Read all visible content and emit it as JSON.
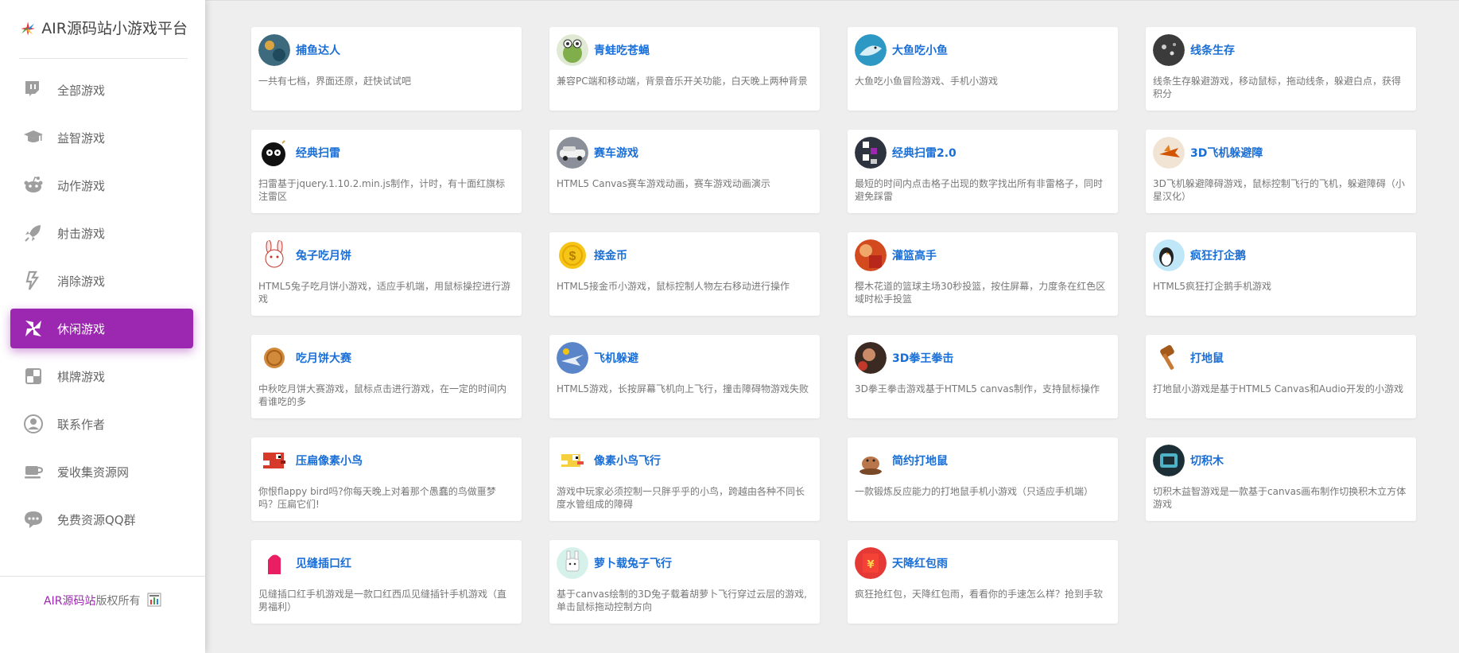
{
  "sidebar": {
    "brand_title": "AIR源码站小游戏平台",
    "items": [
      {
        "label": "全部游戏",
        "icon": "twitch-icon"
      },
      {
        "label": "益智游戏",
        "icon": "graduation-cap-icon"
      },
      {
        "label": "动作游戏",
        "icon": "reddit-robot-icon"
      },
      {
        "label": "射击游戏",
        "icon": "rocket-icon"
      },
      {
        "label": "消除游戏",
        "icon": "blocks-icon"
      },
      {
        "label": "休闲游戏",
        "icon": "pinwheel-icon",
        "active": true
      },
      {
        "label": "棋牌游戏",
        "icon": "cards-grid-icon"
      },
      {
        "label": "联系作者",
        "icon": "user-circle-icon"
      },
      {
        "label": "爱收集资源网",
        "icon": "coffee-cup-icon"
      },
      {
        "label": "免费资源QQ群",
        "icon": "chat-bubble-icon"
      }
    ],
    "footer_brand": "AIR源码站",
    "footer_suffix": "版权所有"
  },
  "accent_color": "#9c27b0",
  "title_color": "#1a6fd6",
  "games": [
    {
      "title": "捕鱼达人",
      "desc": "一共有七档，界面还原，赶快试试吧",
      "icon": "fish-hunter-icon"
    },
    {
      "title": "青蛙吃苍蝇",
      "desc": "兼容PC端和移动端，背景音乐开关功能，白天晚上两种背景",
      "icon": "frog-icon"
    },
    {
      "title": "大鱼吃小鱼",
      "desc": "大鱼吃小鱼冒险游戏、手机小游戏",
      "icon": "shark-icon"
    },
    {
      "title": "线条生存",
      "desc": "线条生存躲避游戏，移动鼠标，拖动线条，躲避白点，获得积分",
      "icon": "dots-icon"
    },
    {
      "title": "经典扫雷",
      "desc": "扫雷基于jquery.1.10.2.min.js制作，计时，有十面红旗标注雷区",
      "icon": "bomb-face-icon"
    },
    {
      "title": "赛车游戏",
      "desc": "HTML5 Canvas赛车游戏动画，赛车游戏动画演示",
      "icon": "racecar-icon"
    },
    {
      "title": "经典扫雷2.0",
      "desc": "最短的时间内点击格子出现的数字找出所有非雷格子，同时避免踩雷",
      "icon": "minesweeper-grid-icon"
    },
    {
      "title": "3D飞机躲避障",
      "desc": "3D飞机躲避障碍游戏，鼠标控制飞行的飞机，躲避障碍（小星汉化）",
      "icon": "plane-3d-icon"
    },
    {
      "title": "兔子吃月饼",
      "desc": "HTML5兔子吃月饼小游戏，适应手机端，用鼠标操控进行游戏",
      "icon": "rabbit-icon"
    },
    {
      "title": "接金币",
      "desc": "HTML5接金币小游戏，鼠标控制人物左右移动进行操作",
      "icon": "gold-coin-icon"
    },
    {
      "title": "灌篮高手",
      "desc": "樱木花道的篮球主场30秒投篮，按住屏幕，力度条在红色区域时松手投篮",
      "icon": "basketball-player-icon"
    },
    {
      "title": "疯狂打企鹅",
      "desc": "HTML5疯狂打企鹅手机游戏",
      "icon": "penguin-icon"
    },
    {
      "title": "吃月饼大赛",
      "desc": "中秋吃月饼大赛游戏，鼠标点击进行游戏，在一定的时间内看谁吃的多",
      "icon": "mooncake-icon"
    },
    {
      "title": "飞机躲避",
      "desc": "HTML5游戏，长按屏幕飞机向上飞行，撞击障碍物游戏失败",
      "icon": "jet-icon"
    },
    {
      "title": "3D拳王拳击",
      "desc": "3D拳王拳击游戏基于HTML5 canvas制作，支持鼠标操作",
      "icon": "boxer-icon"
    },
    {
      "title": "打地鼠",
      "desc": "打地鼠小游戏是基于HTML5 Canvas和Audio开发的小游戏",
      "icon": "hammer-icon"
    },
    {
      "title": "压扁像素小鸟",
      "desc": "你恨flappy bird吗?你每天晚上对着那个愚蠢的鸟做噩梦吗？压扁它们!",
      "icon": "red-pixel-bird-icon"
    },
    {
      "title": "像素小鸟飞行",
      "desc": "游戏中玩家必须控制一只胖乎乎的小鸟，跨越由各种不同长度水管组成的障碍",
      "icon": "flappy-bird-icon"
    },
    {
      "title": "简约打地鼠",
      "desc": "一款锻炼反应能力的打地鼠手机小游戏（只适应手机端）",
      "icon": "mole-icon"
    },
    {
      "title": "切积木",
      "desc": "切积木益智游戏是一款基于canvas画布制作切换积木立方体游戏",
      "icon": "block-cube-icon"
    },
    {
      "title": "见缝插口红",
      "desc": "见缝插口红手机游戏是一款口红西瓜见缝插针手机游戏（直男福利）",
      "icon": "lipstick-icon"
    },
    {
      "title": "萝卜载兔子飞行",
      "desc": "基于canvas绘制的3D兔子载着胡萝卜飞行穿过云层的游戏,单击鼠标拖动控制方向",
      "icon": "bunny-flight-icon"
    },
    {
      "title": "天降红包雨",
      "desc": "疯狂抢红包，天降红包雨，看看你的手速怎么样？抢到手软",
      "icon": "red-envelope-icon"
    }
  ]
}
